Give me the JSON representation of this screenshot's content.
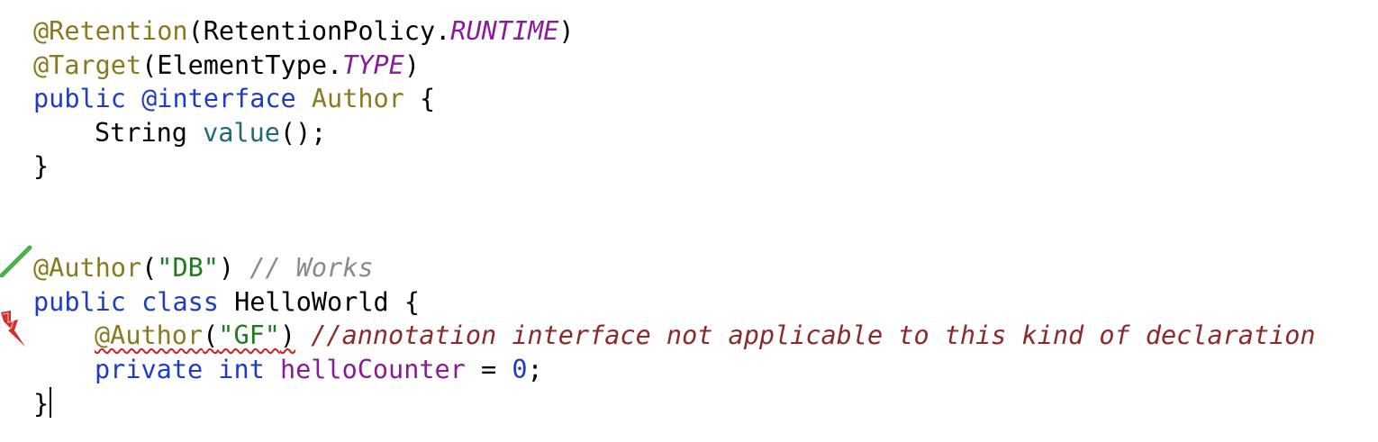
{
  "editor": {
    "lines": [
      {
        "tokens": [
          {
            "t": "@Retention",
            "c": "ann"
          },
          {
            "t": "(RetentionPolicy.",
            "c": ""
          },
          {
            "t": "RUNTIME",
            "c": "italic-const"
          },
          {
            "t": ")",
            "c": ""
          }
        ]
      },
      {
        "tokens": [
          {
            "t": "@Target",
            "c": "ann"
          },
          {
            "t": "(ElementType.",
            "c": ""
          },
          {
            "t": "TYPE",
            "c": "italic-const"
          },
          {
            "t": ")",
            "c": ""
          }
        ]
      },
      {
        "tokens": [
          {
            "t": "public",
            "c": "kw"
          },
          {
            "t": " ",
            "c": ""
          },
          {
            "t": "@interface",
            "c": "kw"
          },
          {
            "t": " ",
            "c": ""
          },
          {
            "t": "Author",
            "c": "ann"
          },
          {
            "t": " {",
            "c": ""
          }
        ]
      },
      {
        "indent": true,
        "tokens": [
          {
            "t": "String ",
            "c": ""
          },
          {
            "t": "value",
            "c": "method"
          },
          {
            "t": "();",
            "c": ""
          }
        ]
      },
      {
        "tokens": [
          {
            "t": "}",
            "c": ""
          }
        ]
      },
      {
        "tokens": []
      },
      {
        "tokens": []
      },
      {
        "marker": "ok",
        "tokens": [
          {
            "t": "@Author",
            "c": "ann"
          },
          {
            "t": "(",
            "c": ""
          },
          {
            "t": "\"DB\"",
            "c": "str"
          },
          {
            "t": ") ",
            "c": ""
          },
          {
            "t": "// Works",
            "c": "comment-ok"
          }
        ]
      },
      {
        "tokens": [
          {
            "t": "public",
            "c": "kw"
          },
          {
            "t": " ",
            "c": ""
          },
          {
            "t": "class",
            "c": "kw"
          },
          {
            "t": " HelloWorld {",
            "c": ""
          }
        ]
      },
      {
        "indent": true,
        "marker": "error",
        "tokens": [
          {
            "t": "@Author",
            "c": "ann err-underline"
          },
          {
            "t": "(",
            "c": "err-underline"
          },
          {
            "t": "\"GF\"",
            "c": "str err-underline"
          },
          {
            "t": ")",
            "c": "err-underline"
          },
          {
            "t": " ",
            "c": ""
          },
          {
            "t": "//annotation interface not applicable to this kind of declaration",
            "c": "comment-err"
          }
        ]
      },
      {
        "indent": true,
        "tokens": [
          {
            "t": "private",
            "c": "kw"
          },
          {
            "t": " ",
            "c": ""
          },
          {
            "t": "int",
            "c": "kw"
          },
          {
            "t": " ",
            "c": ""
          },
          {
            "t": "helloCounter",
            "c": "field"
          },
          {
            "t": " = ",
            "c": ""
          },
          {
            "t": "0",
            "c": "num"
          },
          {
            "t": ";",
            "c": ""
          }
        ]
      },
      {
        "caret": true,
        "tokens": [
          {
            "t": "}",
            "c": ""
          }
        ]
      }
    ]
  },
  "gutter": {
    "ok_marker": "green-check-icon",
    "error_marker": "red-lightning-error-icon"
  },
  "colors": {
    "keyword": "#1e3cc8",
    "annotation": "#8a7a1d",
    "constant": "#8b1a9a",
    "string": "#1f7a1f",
    "comment": "#8a8a8a",
    "error_comment": "#8b2a2a",
    "error_underline": "#d02020",
    "ok_marker": "#4caf50",
    "error_marker": "#d32f2f"
  }
}
